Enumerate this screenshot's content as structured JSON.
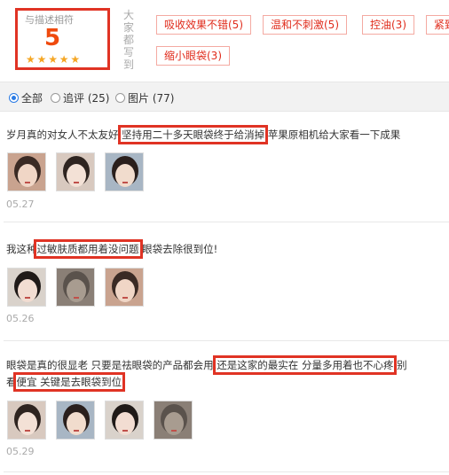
{
  "rating": {
    "title": "与描述相符",
    "score": "5",
    "stars": [
      "★",
      "★",
      "★",
      "★",
      "★"
    ]
  },
  "tags_label": [
    "大",
    "家",
    "都",
    "写",
    "到"
  ],
  "tags": [
    "吸收效果不错(5)",
    "温和不刺激(5)",
    "控油(3)",
    "紧致",
    "缩小眼袋(3)"
  ],
  "filters": [
    {
      "label": "全部",
      "selected": true
    },
    {
      "label": "追评 (25)",
      "selected": false
    },
    {
      "label": "图片 (77)",
      "selected": false
    }
  ],
  "reviews": [
    {
      "segments": [
        "岁月真的对女人不太友好 ",
        "坚持用二十多天眼袋终于给消掉",
        " 苹果原相机给大家看一下成果"
      ],
      "date": "05.27",
      "photos": 3
    },
    {
      "segments": [
        "我这种",
        "过敏肤质都用着没问题",
        " 眼袋去除很到位!"
      ],
      "date": "05.26",
      "photos": 3
    },
    {
      "line1": [
        "眼袋是真的很显老 只要是祛眼袋的产品都会用,",
        "还是这家的最实在 分量多用着也不心疼",
        ",别"
      ],
      "line2": [
        "看",
        "便宜 关键是去眼袋到位",
        ""
      ],
      "date": "05.29",
      "photos": 4
    }
  ],
  "colors": {
    "accent_red": "#e03324",
    "tag_text": "#e02c1c",
    "score_orange": "#ef4a0e",
    "star": "#f5a623",
    "radio_blue": "#2a7be4"
  }
}
